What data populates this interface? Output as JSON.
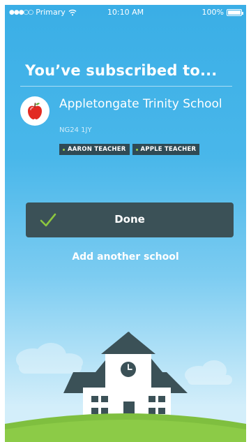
{
  "status_bar": {
    "carrier": "Primary",
    "time": "10:10 AM",
    "battery": "100%"
  },
  "heading": "You’ve subscribed to...",
  "school": {
    "name": "Appletongate Trinity School",
    "postcode": "NG24 1JY",
    "tags": [
      "AARON TEACHER",
      "APPLE TEACHER"
    ]
  },
  "done_button": {
    "label": "Done"
  },
  "add_another_label": "Add another school",
  "icons": {
    "signal": "signal-dots-icon",
    "wifi": "wifi-icon",
    "battery": "battery-icon",
    "logo": "apple-icon",
    "check": "check-icon",
    "illustration": "school-building-illustration"
  },
  "colors": {
    "background": "#49b7ea",
    "button": "#3b5157",
    "check": "#8cc63f",
    "tag_bg": "#2f4a55",
    "grass": "#7fbf3f"
  }
}
